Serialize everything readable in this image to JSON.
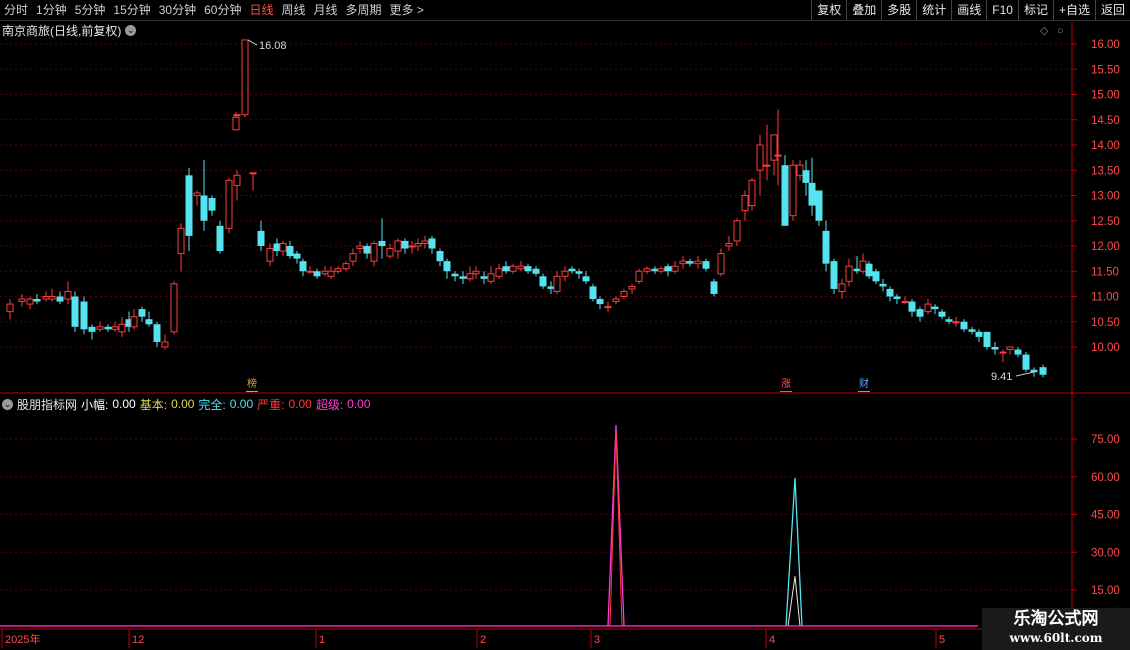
{
  "toolbar": {
    "periods": [
      "分时",
      "1分钟",
      "5分钟",
      "15分钟",
      "30分钟",
      "60分钟",
      "日线",
      "周线",
      "月线",
      "多周期",
      "更多 >"
    ],
    "active_period": "日线",
    "right_buttons": [
      "复权",
      "叠加",
      "多股",
      "统计",
      "画线",
      "F10",
      "标记",
      "+自选",
      "返回"
    ]
  },
  "main_chart": {
    "title": "南京商旅(日线,前复权)",
    "price_axis": [
      "16.00",
      "15.50",
      "15.00",
      "14.50",
      "14.00",
      "13.50",
      "13.00",
      "12.50",
      "12.00",
      "11.50",
      "11.00",
      "10.50",
      "10.00"
    ],
    "high_label": "16.08",
    "low_label": "9.41",
    "tags": [
      {
        "text": "榜",
        "color": "#e0a33a"
      },
      {
        "text": "涨",
        "color": "#ff5a5a"
      },
      {
        "text": "财",
        "color": "#5aa8ff"
      }
    ],
    "colors": {
      "up": "#ff3b3b",
      "down": "#54e3ef"
    }
  },
  "indicator": {
    "name": "股朋指标网",
    "fields": [
      {
        "label": "小幅:",
        "value": "0.00",
        "color": "#ffffff"
      },
      {
        "label": "基本:",
        "value": "0.00",
        "color": "#e6d84a"
      },
      {
        "label": "完全:",
        "value": "0.00",
        "color": "#54e3ef"
      },
      {
        "label": "严重:",
        "value": "0.00",
        "color": "#ff3b3b"
      },
      {
        "label": "超级:",
        "value": "0.00",
        "color": "#ff3bd8"
      }
    ],
    "axis": [
      "75.00",
      "60.00",
      "45.00",
      "30.00",
      "15.00"
    ]
  },
  "time_axis": [
    "2025年",
    "12",
    "1",
    "2",
    "3",
    "4",
    "5"
  ],
  "watermark": {
    "line1": "乐淘公式网",
    "line2": "www.60lt.com"
  }
}
